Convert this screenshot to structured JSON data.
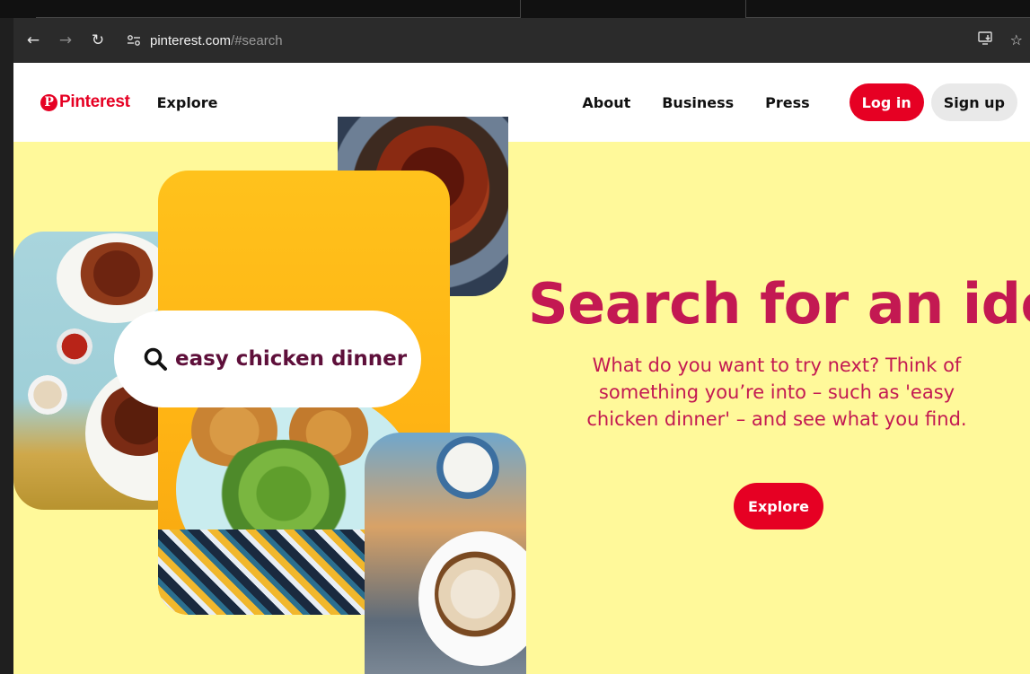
{
  "browser": {
    "url_host": "pinterest.com",
    "url_path": "/#search"
  },
  "header": {
    "logo_text": "Pinterest",
    "explore": "Explore",
    "about": "About",
    "business": "Business",
    "press": "Press",
    "login": "Log in",
    "signup": "Sign up"
  },
  "hero": {
    "search_query": "easy chicken dinner",
    "title": "Search for an idea",
    "description": "What do you want to try next? Think of something you’re into – such as 'easy chicken dinner' – and see what you find.",
    "explore_button": "Explore"
  },
  "colors": {
    "brand_red": "#e60023",
    "hero_text": "#c31952",
    "hero_background": "#fff99a"
  }
}
